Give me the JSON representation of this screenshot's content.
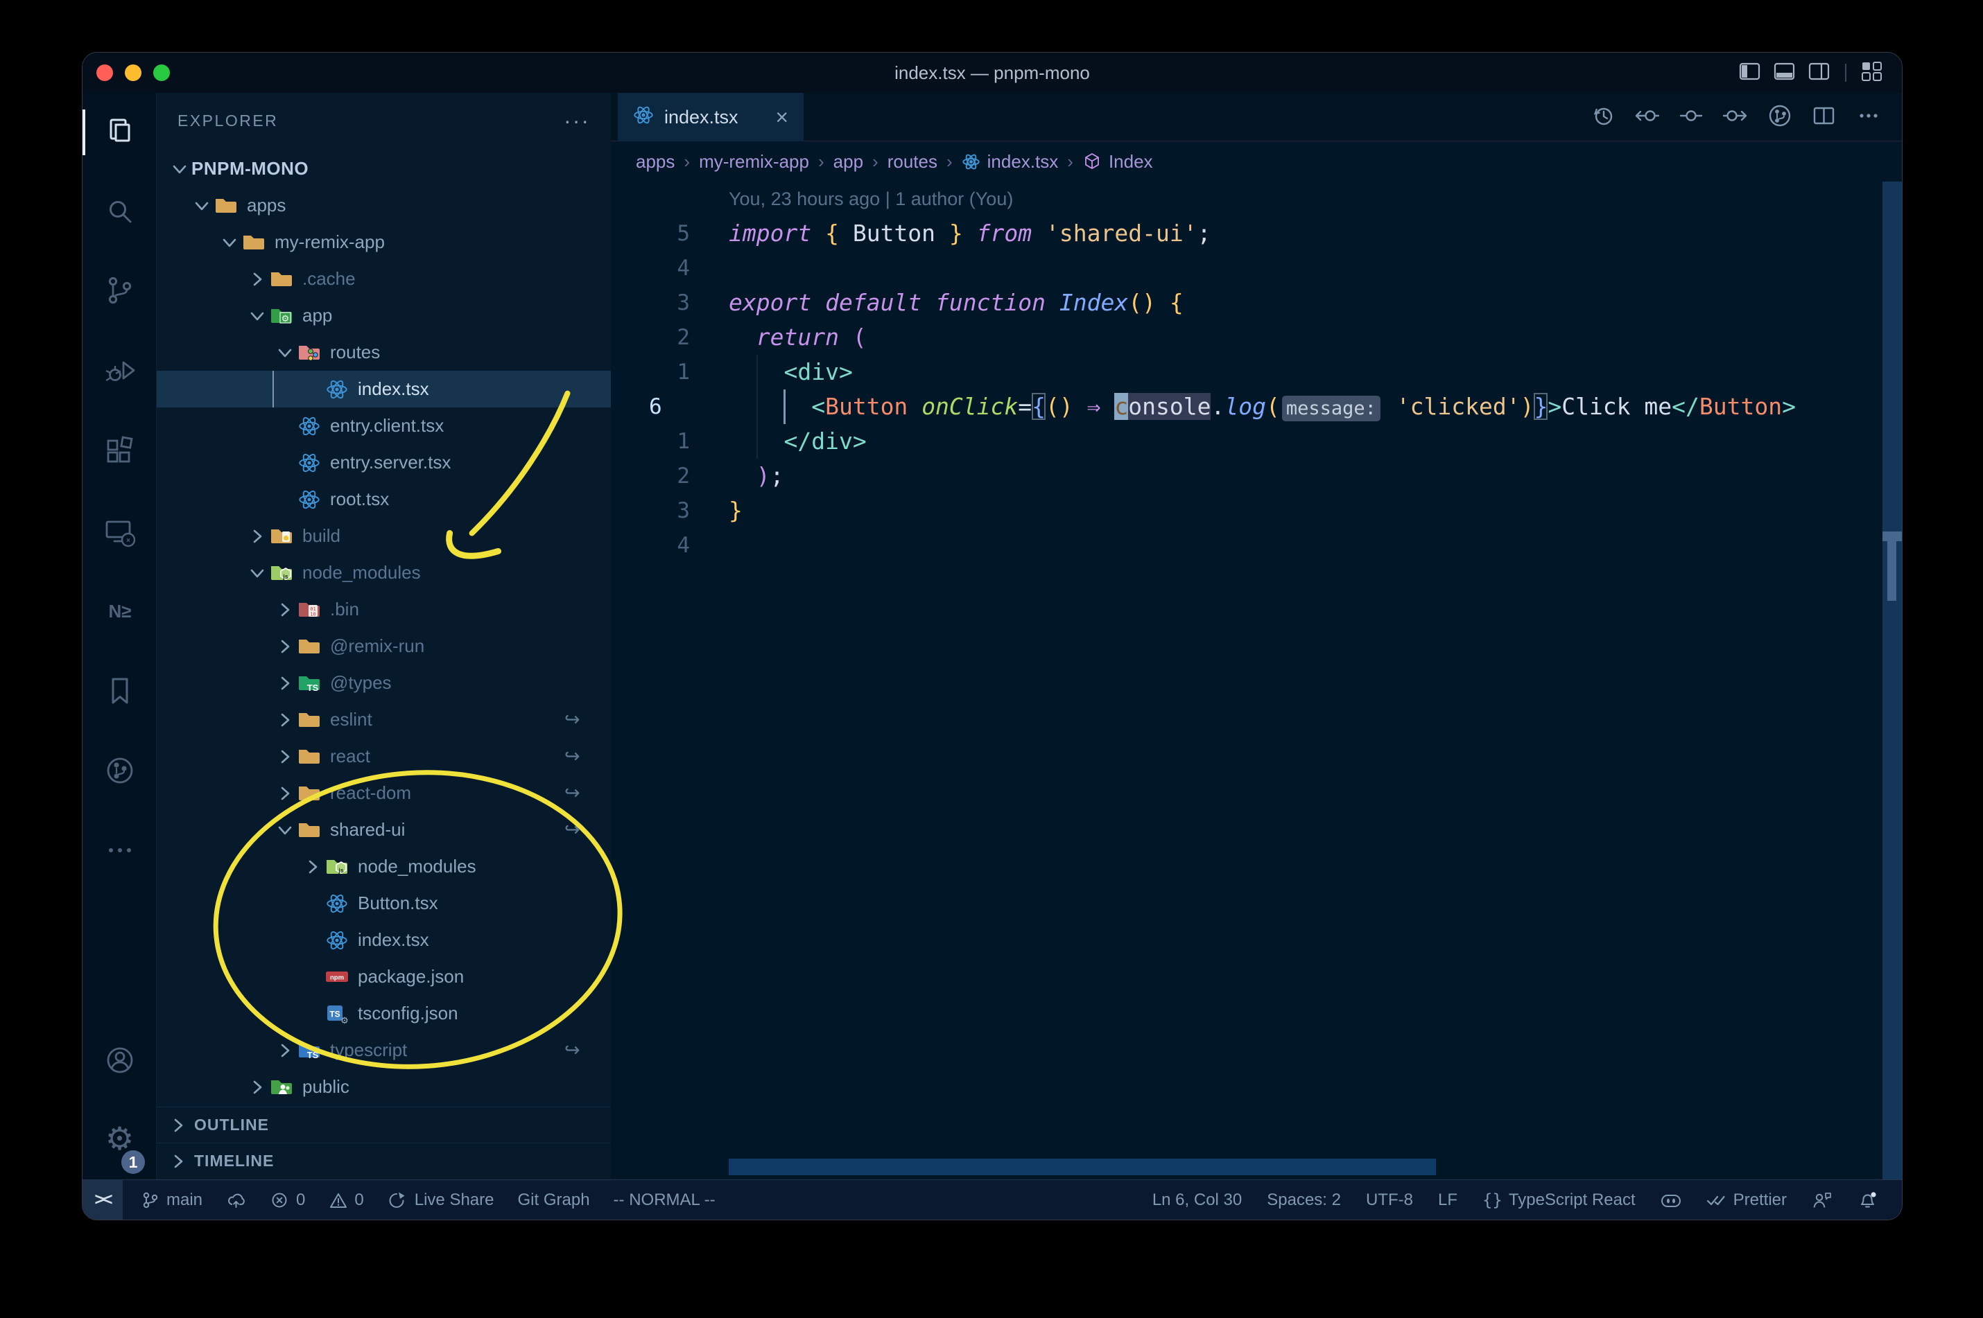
{
  "window": {
    "title": "index.tsx — pnpm-mono"
  },
  "titlebar": {
    "traffic_lights": [
      "close",
      "minimize",
      "zoom"
    ],
    "layout_icons": [
      "layout-sidebar-left",
      "layout-panel",
      "layout-sidebar-right",
      "customize-layout"
    ]
  },
  "activity_bar": {
    "items": [
      {
        "name": "explorer",
        "active": true
      },
      {
        "name": "search"
      },
      {
        "name": "source-control"
      },
      {
        "name": "run-debug"
      },
      {
        "name": "extensions"
      },
      {
        "name": "remote-explorer"
      },
      {
        "name": "nx-console"
      },
      {
        "name": "bookmarks"
      },
      {
        "name": "git-graph"
      },
      {
        "name": "more-views"
      }
    ],
    "bottom": [
      {
        "name": "account"
      },
      {
        "name": "settings",
        "badge": "1"
      }
    ]
  },
  "explorer": {
    "header": "EXPLORER",
    "tree": [
      {
        "label": "PNPM-MONO",
        "level": 0,
        "chevron": "down",
        "project": true
      },
      {
        "label": "apps",
        "level": 1,
        "chevron": "down",
        "icon": "folder-tan"
      },
      {
        "label": "my-remix-app",
        "level": 2,
        "chevron": "down",
        "icon": "folder-tan"
      },
      {
        "label": ".cache",
        "level": 3,
        "chevron": "right",
        "icon": "folder-tan",
        "dim": true
      },
      {
        "label": "app",
        "level": 3,
        "chevron": "down",
        "icon": "folder-app"
      },
      {
        "label": "routes",
        "level": 4,
        "chevron": "down",
        "icon": "folder-routes"
      },
      {
        "label": "index.tsx",
        "level": 5,
        "file": true,
        "icon": "react",
        "selected": true
      },
      {
        "label": "entry.client.tsx",
        "level": 4,
        "file": true,
        "icon": "react"
      },
      {
        "label": "entry.server.tsx",
        "level": 4,
        "file": true,
        "icon": "react"
      },
      {
        "label": "root.tsx",
        "level": 4,
        "file": true,
        "icon": "react"
      },
      {
        "label": "build",
        "level": 3,
        "chevron": "right",
        "icon": "folder-build",
        "dim": true
      },
      {
        "label": "node_modules",
        "level": 3,
        "chevron": "down",
        "icon": "folder-node",
        "dim": true
      },
      {
        "label": ".bin",
        "level": 4,
        "chevron": "right",
        "icon": "folder-bin",
        "dim": true
      },
      {
        "label": "@remix-run",
        "level": 4,
        "chevron": "right",
        "icon": "folder-tan",
        "dim": true
      },
      {
        "label": "@types",
        "level": 4,
        "chevron": "right",
        "icon": "folder-types",
        "dim": true
      },
      {
        "label": "eslint",
        "level": 4,
        "chevron": "right",
        "icon": "folder-tan",
        "dim": true,
        "symlink": true
      },
      {
        "label": "react",
        "level": 4,
        "chevron": "right",
        "icon": "folder-tan",
        "dim": true,
        "symlink": true
      },
      {
        "label": "react-dom",
        "level": 4,
        "chevron": "right",
        "icon": "folder-tan",
        "dim": true,
        "symlink": true
      },
      {
        "label": "shared-ui",
        "level": 4,
        "chevron": "down",
        "icon": "folder-tan",
        "symlink": true
      },
      {
        "label": "node_modules",
        "level": 5,
        "chevron": "right",
        "icon": "folder-node"
      },
      {
        "label": "Button.tsx",
        "level": 5,
        "file": true,
        "icon": "react"
      },
      {
        "label": "index.tsx",
        "level": 5,
        "file": true,
        "icon": "react"
      },
      {
        "label": "package.json",
        "level": 5,
        "file": true,
        "icon": "npm"
      },
      {
        "label": "tsconfig.json",
        "level": 5,
        "file": true,
        "icon": "tsconfig"
      },
      {
        "label": "typescript",
        "level": 4,
        "chevron": "right",
        "icon": "folder-ts",
        "dim": true,
        "symlink": true
      },
      {
        "label": "public",
        "level": 3,
        "chevron": "right",
        "icon": "folder-public"
      }
    ],
    "sections": [
      "OUTLINE",
      "TIMELINE"
    ]
  },
  "tabs": {
    "active": {
      "label": "index.tsx",
      "icon": "react",
      "close": "×"
    },
    "actions": [
      "history",
      "previous-change",
      "change",
      "next-change",
      "source-control-graph",
      "split-editor",
      "more-actions"
    ]
  },
  "breadcrumbs": {
    "separator": "›",
    "items": [
      {
        "label": "apps"
      },
      {
        "label": "my-remix-app"
      },
      {
        "label": "app"
      },
      {
        "label": "routes"
      },
      {
        "label": "index.tsx",
        "icon": "react"
      },
      {
        "label": "Index",
        "icon": "symbol-cube"
      }
    ]
  },
  "editor": {
    "blame": "You, 23 hours ago | 1 author (You)",
    "lines": [
      {
        "blame": true
      },
      {
        "rel": "5",
        "tokens": [
          [
            "import",
            "kw"
          ],
          [
            " ",
            "fg"
          ],
          [
            "{",
            "gold"
          ],
          [
            " Button ",
            "fg"
          ],
          [
            "}",
            "gold"
          ],
          [
            " ",
            "fg"
          ],
          [
            "from",
            "kw"
          ],
          [
            " ",
            "fg"
          ],
          [
            "'shared-ui'",
            "str"
          ],
          [
            ";",
            "fg"
          ]
        ]
      },
      {
        "rel": "4",
        "tokens": []
      },
      {
        "rel": "3",
        "tokens": [
          [
            "export",
            "kw"
          ],
          [
            " ",
            "fg"
          ],
          [
            "default",
            "kw"
          ],
          [
            " ",
            "fg"
          ],
          [
            "function",
            "kw"
          ],
          [
            " ",
            "fg"
          ],
          [
            "Index",
            "fn"
          ],
          [
            "()",
            "gold"
          ],
          [
            " ",
            "fg"
          ],
          [
            "{",
            "gold"
          ]
        ]
      },
      {
        "rel": "2",
        "tokens": [
          [
            "  ",
            "fg"
          ],
          [
            "return",
            "kw"
          ],
          [
            " ",
            "fg"
          ],
          [
            "(",
            "mag"
          ]
        ]
      },
      {
        "rel": "1",
        "guides": [
          2
        ],
        "tokens": [
          [
            "    ",
            "fg"
          ],
          [
            "<div>",
            "teal"
          ]
        ]
      },
      {
        "abs": "6",
        "active": true,
        "guides": [
          2
        ],
        "tokens": [
          [
            "      ",
            "fg"
          ],
          [
            "<",
            "teal"
          ],
          [
            "Button",
            "tag"
          ],
          [
            " ",
            "fg"
          ],
          [
            "onClick",
            "attr"
          ],
          [
            "=",
            "fg"
          ],
          [
            "{",
            "blueb"
          ],
          [
            "()",
            "gold"
          ],
          [
            " ",
            "fg"
          ],
          [
            "⇒",
            "mag"
          ],
          [
            " ",
            "fg"
          ],
          [
            "c",
            "cursor"
          ],
          [
            "onsole",
            "hl"
          ],
          [
            ".",
            "fg"
          ],
          [
            "log",
            "fn"
          ],
          [
            "(",
            "gold"
          ],
          [
            "message:",
            "inlay"
          ],
          [
            " ",
            "fg"
          ],
          [
            "'clicked'",
            "str"
          ],
          [
            ")",
            "gold"
          ],
          [
            "}",
            "blueb"
          ],
          [
            ">",
            "teal"
          ],
          [
            "Click me",
            "fg"
          ],
          [
            "</",
            "teal"
          ],
          [
            "Button",
            "tag"
          ],
          [
            ">",
            "teal"
          ]
        ]
      },
      {
        "rel": "1",
        "guides": [
          2
        ],
        "tokens": [
          [
            "    ",
            "fg"
          ],
          [
            "</div>",
            "teal"
          ]
        ]
      },
      {
        "rel": "2",
        "tokens": [
          [
            "  ",
            "fg"
          ],
          [
            ")",
            "mag"
          ],
          [
            ";",
            "fg"
          ]
        ]
      },
      {
        "rel": "3",
        "tokens": [
          [
            "}",
            "gold"
          ]
        ]
      },
      {
        "rel": "4",
        "tokens": []
      }
    ],
    "cursor_position": "Ln 6, Col 30"
  },
  "status_bar": {
    "left": [
      {
        "icon": "remote-indicator",
        "label": "><"
      },
      {
        "icon": "git-branch",
        "label": "main"
      },
      {
        "icon": "cloud-upload",
        "label": ""
      },
      {
        "icon": "error",
        "label": "0"
      },
      {
        "icon": "warning",
        "label": "0"
      },
      {
        "icon": "live-share",
        "label": "Live Share"
      },
      {
        "icon": "",
        "label": "Git Graph"
      },
      {
        "icon": "",
        "label": "-- NORMAL --"
      }
    ],
    "right": [
      {
        "icon": "",
        "label": "Ln 6, Col 30"
      },
      {
        "icon": "",
        "label": "Spaces: 2"
      },
      {
        "icon": "",
        "label": "UTF-8"
      },
      {
        "icon": "",
        "label": "LF"
      },
      {
        "icon": "braces",
        "label": "TypeScript React"
      },
      {
        "icon": "copilot",
        "label": ""
      },
      {
        "icon": "double-check",
        "label": "Prettier"
      },
      {
        "icon": "feedback",
        "label": ""
      },
      {
        "icon": "bell-dot",
        "label": ""
      }
    ]
  },
  "annotations": {
    "color": "#f0e23b"
  },
  "colors": {
    "editor_bg": "#011627",
    "sidebar_bg": "#061a2c",
    "selection_bg": "#17344f",
    "tab_active_bg": "#0c2740",
    "keyword": "#c792ea",
    "string": "#ecc48d",
    "tag": "#f78c6c",
    "attribute": "#addb67",
    "function": "#82aaff",
    "tag_punctuation": "#7fdbca",
    "bracket_gold": "#ffcb6b",
    "traffic_red": "#ff5f57",
    "traffic_yellow": "#febc2e",
    "traffic_green": "#28c840",
    "annotation_yellow": "#f0e23b"
  }
}
